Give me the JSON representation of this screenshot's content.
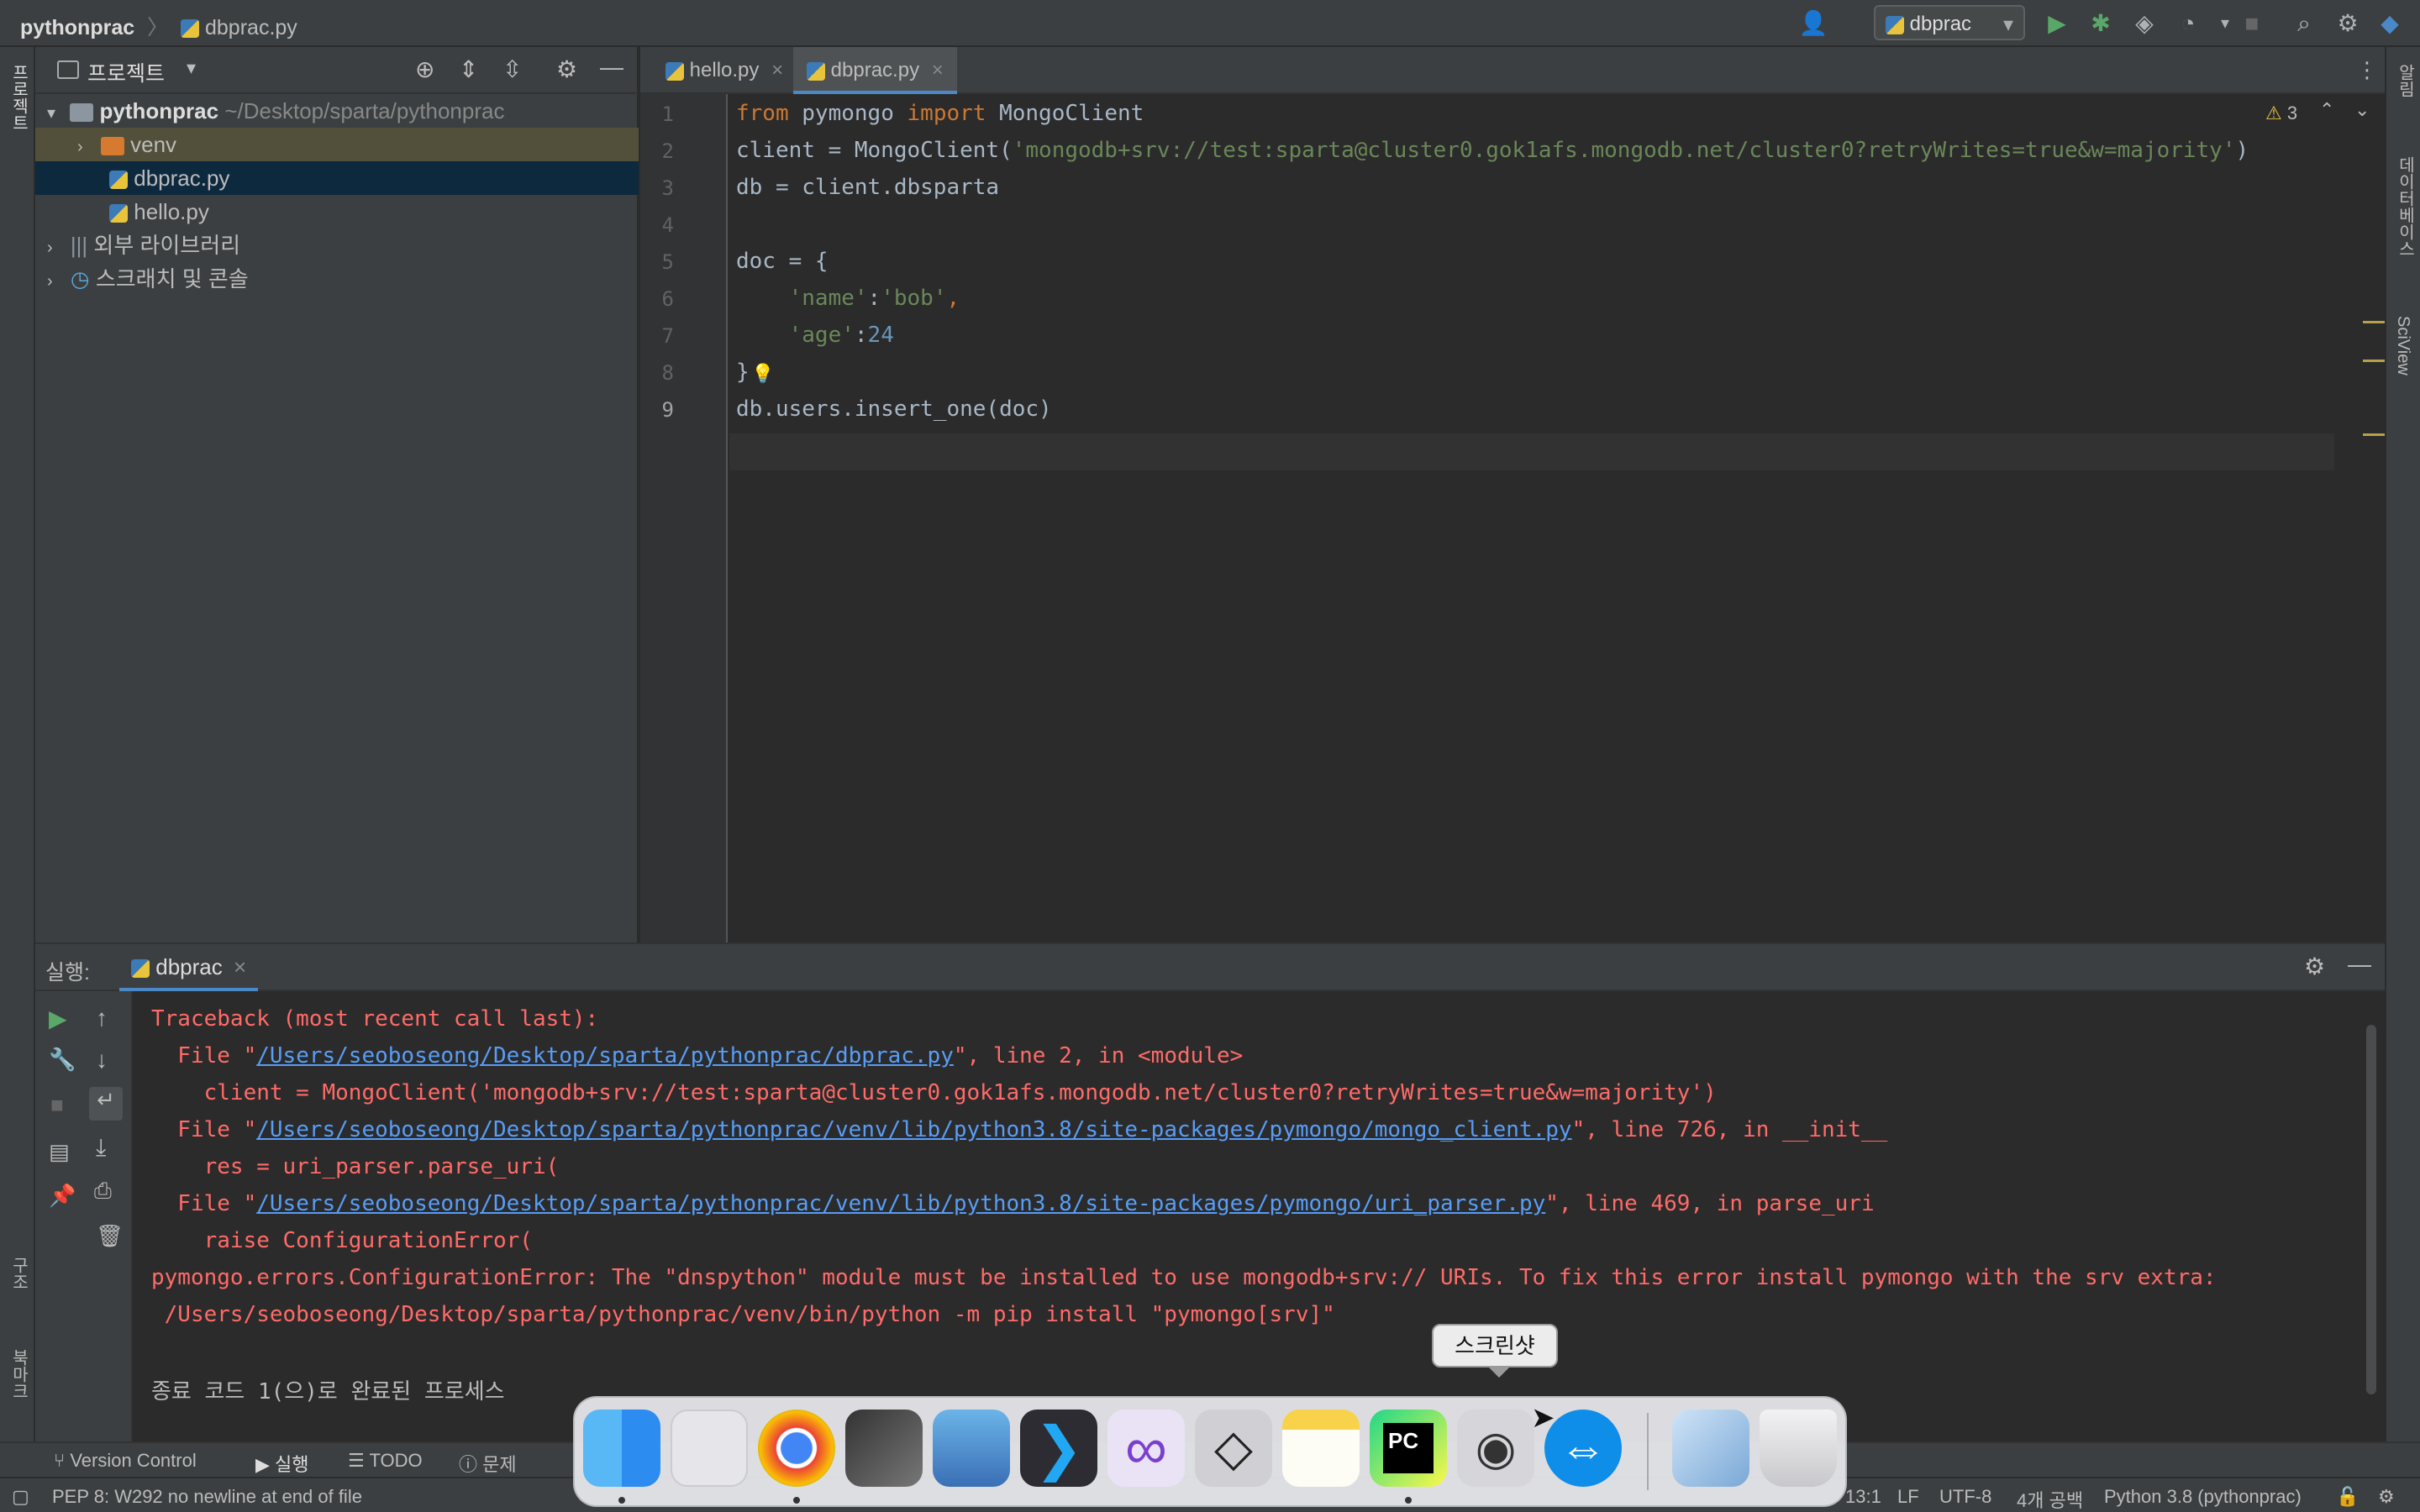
{
  "titlebar": {
    "project": "pythonprac",
    "file": "dbprac.py",
    "run_config": "dbprac"
  },
  "left_stripe": {
    "project_tab": "프로젝트",
    "structure_tab": "구조",
    "bookmarks_tab": "북마크"
  },
  "right_stripe": {
    "notifications": "알림",
    "database": "데이터베이스",
    "sciview": "SciView"
  },
  "project_panel": {
    "title": "프로젝트",
    "root": "pythonprac",
    "root_path": "~/Desktop/sparta/pythonprac",
    "items": [
      {
        "label": "venv"
      },
      {
        "label": "dbprac.py"
      },
      {
        "label": "hello.py"
      },
      {
        "label": "외부 라이브러리"
      },
      {
        "label": "스크래치 및 콘솔"
      }
    ]
  },
  "editor": {
    "tabs": [
      {
        "label": "hello.py"
      },
      {
        "label": "dbprac.py"
      }
    ],
    "warnings": "3",
    "lines": [
      "1",
      "2",
      "3",
      "4",
      "5",
      "6",
      "7",
      "8",
      "9"
    ],
    "code": {
      "l1_kw1": "from",
      "l1_mod": " pymongo ",
      "l1_kw2": "import",
      "l1_rest": " MongoClient",
      "l2_pre": "client = MongoClient(",
      "l2_str": "'mongodb+srv://test:sparta@cluster0.gok1afs.mongodb.net/cluster0?retryWrites=true&w=majority'",
      "l2_post": ")",
      "l3": "db = client.dbsparta",
      "l5": "doc = {",
      "l6_str1": "    'name'",
      "l6_colon": ":",
      "l6_str2": "'bob'",
      "l6_comma": ",",
      "l7_str": "    'age'",
      "l7_colon": ":",
      "l7_num": "24",
      "l8": "}",
      "l9": "db.users.insert_one(doc)"
    }
  },
  "run_panel": {
    "label": "실행:",
    "tab": "dbprac",
    "output": {
      "o1": "Traceback (most recent call last):",
      "o2_pre": "  File \"",
      "o2_link": "/Users/seoboseong/Desktop/sparta/pythonprac/dbprac.py",
      "o2_post": "\", line 2, in <module>",
      "o3": "    client = MongoClient('mongodb+srv://test:sparta@cluster0.gok1afs.mongodb.net/cluster0?retryWrites=true&w=majority')",
      "o4_pre": "  File \"",
      "o4_link": "/Users/seoboseong/Desktop/sparta/pythonprac/venv/lib/python3.8/site-packages/pymongo/mongo_client.py",
      "o4_post": "\", line 726, in __init__",
      "o5": "    res = uri_parser.parse_uri(",
      "o6_pre": "  File \"",
      "o6_link": "/Users/seoboseong/Desktop/sparta/pythonprac/venv/lib/python3.8/site-packages/pymongo/uri_parser.py",
      "o6_post": "\", line 469, in parse_uri",
      "o7": "    raise ConfigurationError(",
      "o8": "pymongo.errors.ConfigurationError: The \"dnspython\" module must be installed to use mongodb+srv:// URIs. To fix this error install pymongo with the srv extra:",
      "o9": " /Users/seoboseong/Desktop/sparta/pythonprac/venv/bin/python -m pip install \"pymongo[srv]\"",
      "o10": "종료 코드 1(으)로 완료된 프로세스"
    }
  },
  "tool_windows": [
    {
      "label": "Version Control"
    },
    {
      "label": "실행"
    },
    {
      "label": "TODO"
    },
    {
      "label": "문제"
    }
  ],
  "status": {
    "message": "PEP 8: W292 no newline at end of file",
    "position": "13:1",
    "line_sep": "LF",
    "encoding": "UTF-8",
    "indent": "4개 공백",
    "interpreter": "Python 3.8 (pythonprac)"
  },
  "dock": {
    "tooltip": "스크린샷",
    "apps": [
      "finder-icon",
      "launchpad-icon",
      "chrome-icon",
      "final-cut-icon",
      "preview-icon",
      "vscode-icon",
      "visual-studio-icon",
      "unity-icon",
      "notes-icon",
      "pycharm-icon",
      "screenshot-icon",
      "teamviewer-icon",
      "downloads-icon",
      "trash-icon"
    ]
  },
  "colors": {
    "keyword": "#cc7832",
    "string": "#6a8759",
    "number": "#6897bb",
    "error": "#ff6b68",
    "link": "#589df6"
  }
}
